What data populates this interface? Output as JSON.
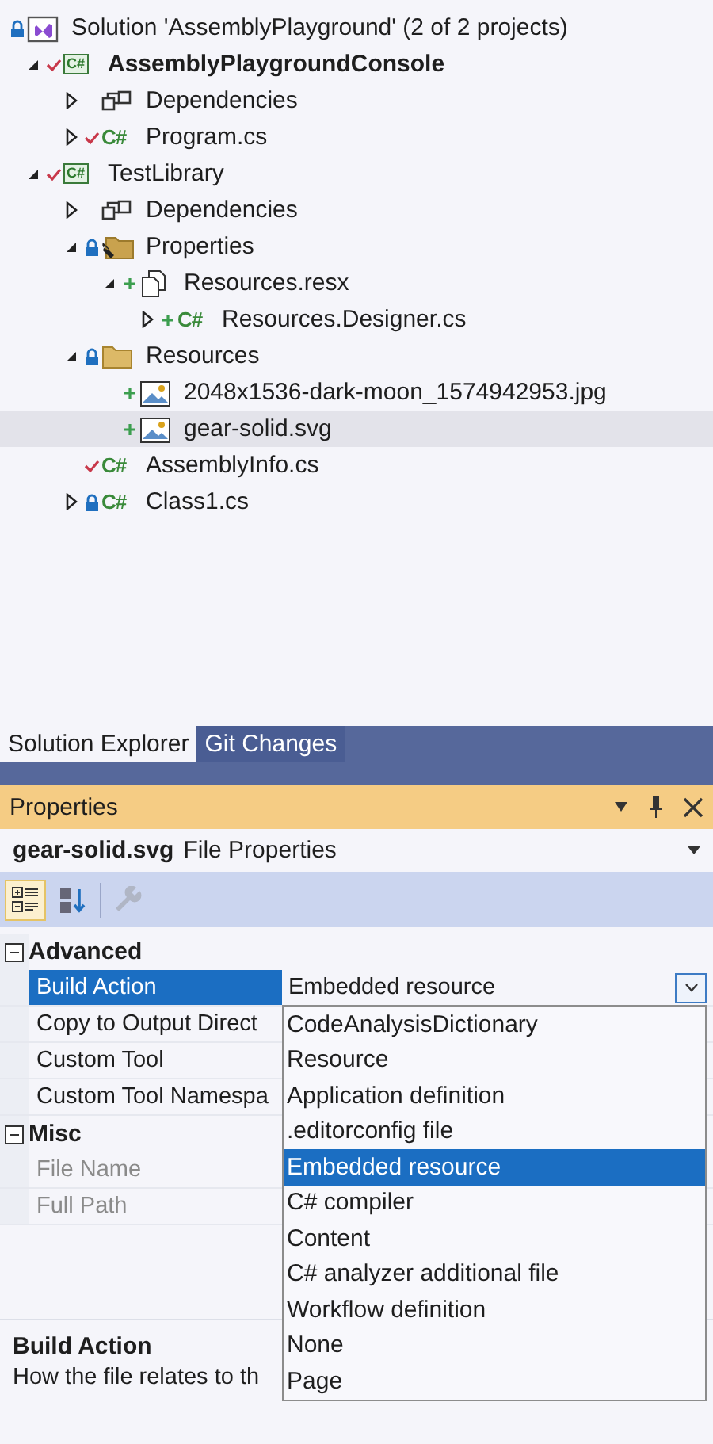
{
  "solution_explorer": {
    "tree": [
      {
        "label": "Solution 'AssemblyPlayground' (2 of 2 projects)",
        "kind": "solution",
        "locked": true,
        "checked_in": false,
        "added": false,
        "selected": false,
        "bold": false,
        "children": [
          {
            "label": "AssemblyPlaygroundConsole",
            "kind": "csproj",
            "icon_text": "C#",
            "locked": false,
            "checked_in": true,
            "added": false,
            "expanded": true,
            "selected": false,
            "bold": true,
            "children": [
              {
                "label": "Dependencies",
                "kind": "dependencies",
                "locked": false,
                "checked_in": false,
                "added": false,
                "expanded": false,
                "selected": false,
                "bold": false
              },
              {
                "label": "Program.cs",
                "kind": "csfile",
                "icon_text": "C#",
                "locked": false,
                "checked_in": true,
                "added": false,
                "expanded": false,
                "selected": false,
                "bold": false
              }
            ]
          },
          {
            "label": "TestLibrary",
            "kind": "csproj",
            "icon_text": "C#",
            "locked": false,
            "checked_in": true,
            "added": false,
            "expanded": true,
            "selected": false,
            "bold": false,
            "children": [
              {
                "label": "Dependencies",
                "kind": "dependencies",
                "locked": false,
                "checked_in": false,
                "added": false,
                "expanded": false,
                "selected": false,
                "bold": false
              },
              {
                "label": "Properties",
                "kind": "propsfolder",
                "locked": true,
                "checked_in": false,
                "added": false,
                "expanded": true,
                "selected": false,
                "bold": false,
                "children": [
                  {
                    "label": "Resources.resx",
                    "kind": "resx",
                    "locked": false,
                    "checked_in": false,
                    "added": true,
                    "expanded": true,
                    "selected": false,
                    "bold": false,
                    "children": [
                      {
                        "label": "Resources.Designer.cs",
                        "kind": "csfile",
                        "icon_text": "C#",
                        "locked": false,
                        "checked_in": false,
                        "added": true,
                        "expanded": false,
                        "selected": false,
                        "bold": false
                      }
                    ]
                  }
                ]
              },
              {
                "label": "Resources",
                "kind": "folder",
                "locked": true,
                "checked_in": false,
                "added": false,
                "expanded": true,
                "selected": false,
                "bold": false,
                "children": [
                  {
                    "label": "2048x1536-dark-moon_1574942953.jpg",
                    "kind": "image",
                    "locked": false,
                    "checked_in": false,
                    "added": true,
                    "selected": false,
                    "bold": false
                  },
                  {
                    "label": "gear-solid.svg",
                    "kind": "image",
                    "locked": false,
                    "checked_in": false,
                    "added": true,
                    "selected": true,
                    "bold": false
                  }
                ]
              },
              {
                "label": "AssemblyInfo.cs",
                "kind": "csfile",
                "icon_text": "C#",
                "locked": false,
                "checked_in": true,
                "added": false,
                "selected": false,
                "bold": false
              },
              {
                "label": "Class1.cs",
                "kind": "csfile",
                "icon_text": "C#",
                "locked": true,
                "checked_in": false,
                "added": false,
                "expanded": false,
                "selected": false,
                "bold": false
              }
            ]
          }
        ]
      }
    ]
  },
  "tool_tabs": [
    {
      "label": "Solution Explorer",
      "selected": true
    },
    {
      "label": "Git Changes",
      "selected": false
    }
  ],
  "properties": {
    "title": "Properties",
    "object_name": "gear-solid.svg",
    "object_type": "File Properties",
    "toolbar": [
      {
        "kind": "categorized",
        "selected": true,
        "disabled": false
      },
      {
        "kind": "alphabetical",
        "selected": false,
        "disabled": false
      },
      {
        "kind": "propertypages",
        "selected": false,
        "disabled": true
      }
    ],
    "categories": [
      {
        "name": "Advanced",
        "expanded": true,
        "properties": [
          {
            "name": "Build Action",
            "value": "Embedded resource",
            "selected": true,
            "readonly": false
          },
          {
            "name": "Copy to Output Direct",
            "selected": false,
            "readonly": false
          },
          {
            "name": "Custom Tool",
            "selected": false,
            "readonly": false
          },
          {
            "name": "Custom Tool Namespa",
            "selected": false,
            "readonly": false
          }
        ]
      },
      {
        "name": "Misc",
        "expanded": true,
        "properties": [
          {
            "name": "File Name",
            "selected": false,
            "readonly": true
          },
          {
            "name": "Full Path",
            "selected": false,
            "readonly": true
          }
        ]
      }
    ],
    "dropdown": {
      "options": [
        {
          "label": "CodeAnalysisDictionary",
          "selected": false
        },
        {
          "label": "Resource",
          "selected": false
        },
        {
          "label": "Application definition",
          "selected": false
        },
        {
          "label": ".editorconfig file",
          "selected": false
        },
        {
          "label": "Embedded resource",
          "selected": true
        },
        {
          "label": "C# compiler",
          "selected": false
        },
        {
          "label": "Content",
          "selected": false
        },
        {
          "label": "C# analyzer additional file",
          "selected": false
        },
        {
          "label": "Workflow definition",
          "selected": false
        },
        {
          "label": "None",
          "selected": false
        },
        {
          "label": "Page",
          "selected": false
        }
      ]
    },
    "description": {
      "title": "Build Action",
      "text": "How the file relates to th"
    }
  }
}
